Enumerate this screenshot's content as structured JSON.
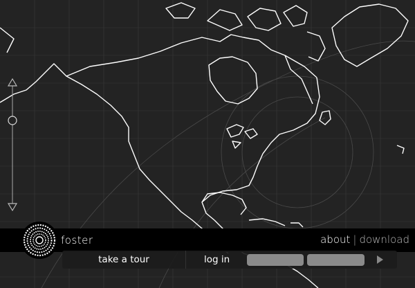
{
  "app": {
    "brand_name": "foster"
  },
  "nav": {
    "about_label": "about",
    "separator": "|",
    "download_label": "download"
  },
  "controls": {
    "tour_label": "take a tour",
    "login_label": "log in",
    "username_placeholder": "",
    "password_placeholder": ""
  },
  "zoom": {
    "level": 0.28
  },
  "colors": {
    "background": "#232323",
    "map_line": "#ffffff",
    "bar": "#000000",
    "field": "#8a8a8a"
  },
  "icons": [
    "zoom-in-icon",
    "zoom-out-icon",
    "logo-ring-icon",
    "submit-arrow-icon"
  ]
}
